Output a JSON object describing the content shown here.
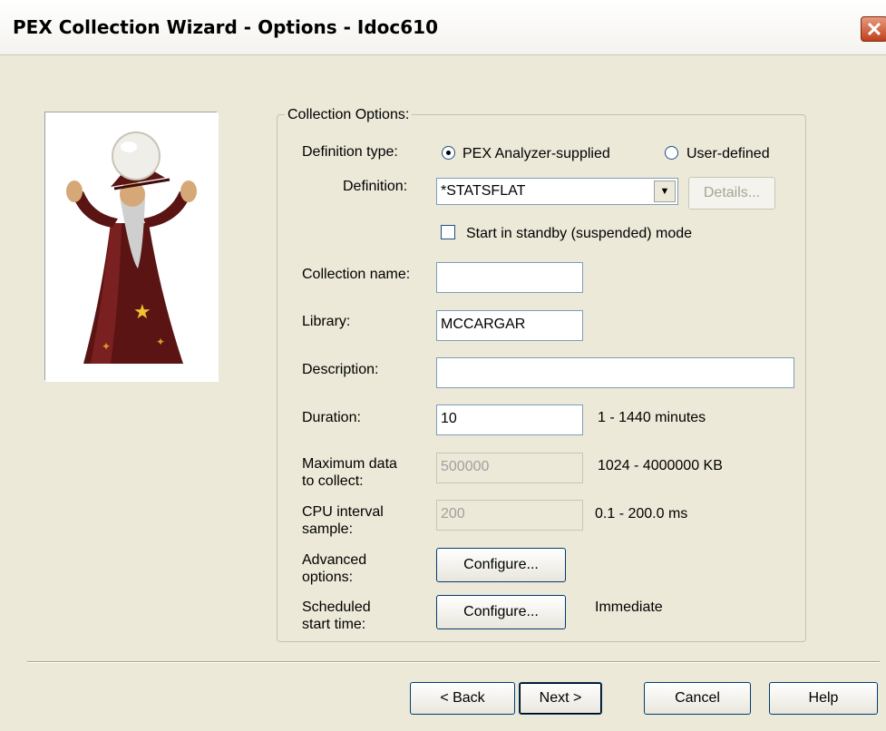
{
  "window": {
    "title": "PEX Collection Wizard - Options - Idoc610",
    "close_glyph": "✕"
  },
  "group": {
    "legend": "Collection Options:"
  },
  "definition_type": {
    "label": "Definition type:",
    "option_supplied": "PEX Analyzer-supplied",
    "option_user": "User-defined",
    "selected": "supplied"
  },
  "definition": {
    "label": "Definition:",
    "value": "*STATSFLAT",
    "details_button": "Details..."
  },
  "standby": {
    "label": "Start in standby (suspended) mode",
    "checked": false
  },
  "collection_name": {
    "label": "Collection name:",
    "value": ""
  },
  "library": {
    "label": "Library:",
    "value": "MCCARGAR"
  },
  "description": {
    "label": "Description:",
    "value": ""
  },
  "duration": {
    "label": "Duration:",
    "value": "10",
    "range": "1 - 1440 minutes"
  },
  "max_data": {
    "label": "Maximum data\nto collect:",
    "value": "500000",
    "range": "1024 - 4000000 KB"
  },
  "cpu_interval": {
    "label": "CPU interval\nsample:",
    "value": "200",
    "range": "0.1 - 200.0 ms"
  },
  "advanced": {
    "label": "Advanced\noptions:",
    "button": "Configure..."
  },
  "scheduled": {
    "label": "Scheduled\nstart time:",
    "button": "Configure...",
    "value": "Immediate"
  },
  "footer": {
    "back": "< Back",
    "next": "Next >",
    "cancel": "Cancel",
    "help": "Help"
  },
  "icons": {
    "wizard": "wizard-illustration-icon",
    "close": "close-icon",
    "dropdown": "chevron-down-icon"
  }
}
